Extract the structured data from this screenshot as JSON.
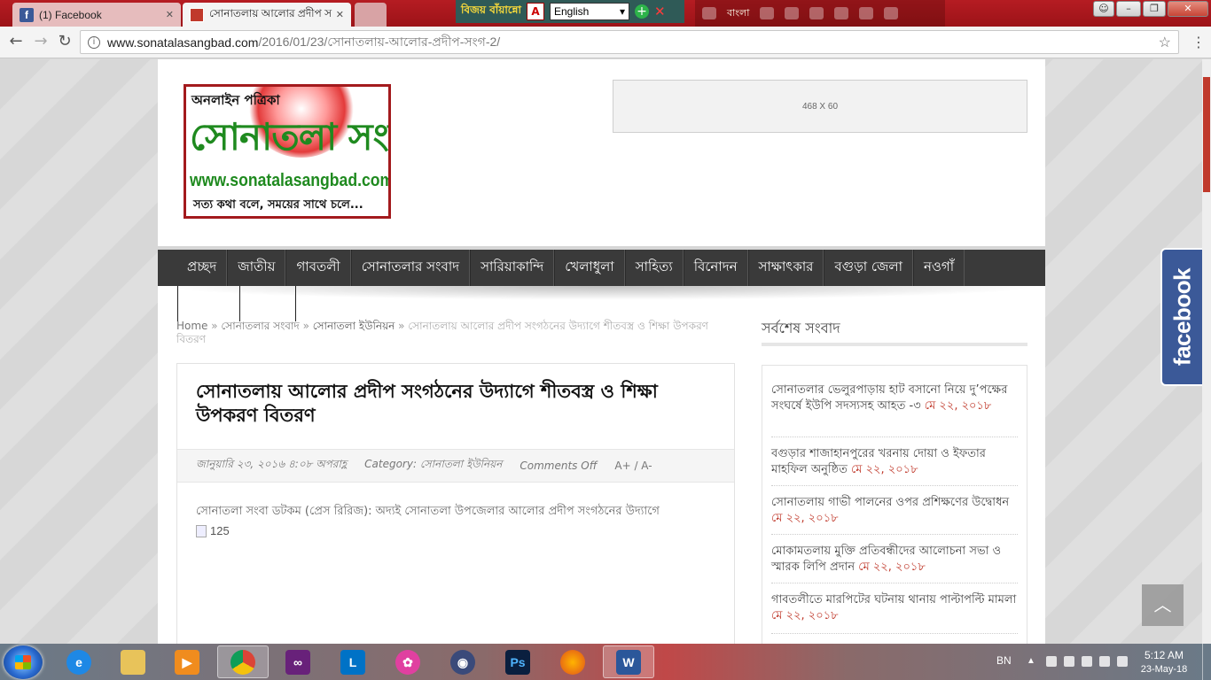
{
  "browser": {
    "tabs": [
      {
        "title": "(1) Facebook",
        "favicon": "facebook-icon"
      },
      {
        "title": "সোনাতলায় আলোর প্রদীপ স",
        "favicon": "sonatala-icon"
      }
    ],
    "url_host": "www.sonatalasangbad.com",
    "url_path": "/2016/01/23/সোনাতলায়-আলোর-প্রদীপ-সংগ-2/"
  },
  "bijoy_bar": {
    "brand": "বিজয় বাঁয়ান্নো",
    "keyboard_language": "English"
  },
  "ime_bar": {
    "language": "বাংলা"
  },
  "site": {
    "logo": {
      "top_text": "অনলাইন পত্রিকা",
      "main_text": "সোনাতলা সংবাদ",
      "url_text": "www.sonatalasangbad.com",
      "tagline": "সত্য কথা বলে, সময়ের সাথে চলে..."
    },
    "ad_text": "468 X 60",
    "nav": [
      "প্রচ্ছদ",
      "জাতীয়",
      "গাবতলী",
      "সোনাতলার সংবাদ",
      "সারিয়াকান্দি",
      "খেলাধুলা",
      "সাহিত্য",
      "বিনোদন",
      "সাক্ষাৎকার",
      "বগুড়া জেলা",
      "নওগাঁ"
    ],
    "breadcrumb": {
      "home": "Home",
      "sep": " » ",
      "cat1": "সোনাতলার সংবাদ",
      "cat2": "সোনাতলা ইউনিয়ন",
      "current": "সোনাতলায় আলোর প্রদীপ সংগঠনের উদ্যাগে শীতবস্ত্র ও শিক্ষা উপকরণ বিতরণ"
    },
    "article": {
      "title": "সোনাতলায় আলোর প্রদীপ সংগঠনের উদ্যাগে শীতবস্ত্র ও শিক্ষা উপকরণ বিতরণ",
      "date": "জানুয়ারি ২৩, ২০১৬ ৪:০৮ অপরাহ্ণ",
      "category": "Category: সোনাতলা ইউনিয়ন",
      "comments": "Comments Off",
      "font_size": "A+ / A-",
      "body": "সোনাতলা সংবা ডটকম (প্রেস রিরিজ): অদ্যই সোনাতলা উপজেলার আলোর প্রদীপ সংগঠনের উদ্যাগে",
      "image_alt": "125"
    },
    "sidebar": {
      "title": "সর্বশেষ সংবাদ",
      "items": [
        {
          "text": "সোনাতলার ভেলুরপাড়ায় হাট বসানো নিয়ে দু’পক্ষের সংঘর্ষে ইউপি সদস্যসহ আহত -৩ ",
          "date": "মে ২২, ২০১৮"
        },
        {
          "text": "বগুড়ার শাজাহানপুরের খরনায় দোয়া ও ইফতার মাহফিল অনুষ্ঠিত ",
          "date": "মে ২২, ২০১৮"
        },
        {
          "text": "সোনাতলায় গাভী পালনের ওপর প্রশিক্ষণের উদ্বোধন ",
          "date": "মে ২২, ২০১৮"
        },
        {
          "text": "মোকামতলায় মুক্তি প্রতিবন্ধীদের আলোচনা সভা ও স্মারক লিপি প্রদান ",
          "date": "মে ২২, ২০১৮"
        },
        {
          "text": "গাবতলীতে মারপিটের ঘটনায় থানায় পাল্টাপল্টি মামলা ",
          "date": "মে ২২, ২০১৮"
        }
      ]
    },
    "facebook_tab": "facebook"
  },
  "taskbar": {
    "language": "BN",
    "time": "5:12 AM",
    "date": "23-May-18"
  }
}
